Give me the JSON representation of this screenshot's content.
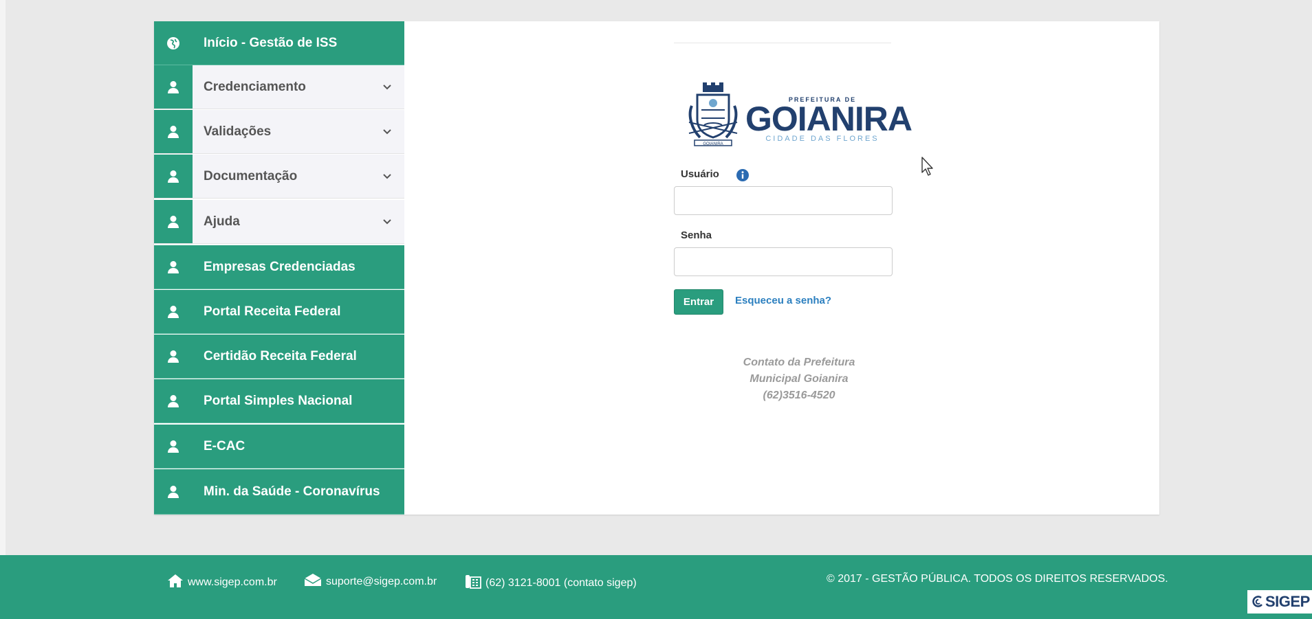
{
  "sidebar": {
    "items": [
      {
        "label": "Início - Gestão de ISS",
        "style": "green",
        "icon": "globe-icon",
        "has_submenu": false
      },
      {
        "label": "Credenciamento",
        "style": "light",
        "icon": "user-icon",
        "has_submenu": true
      },
      {
        "label": "Validações",
        "style": "light",
        "icon": "user-icon",
        "has_submenu": true
      },
      {
        "label": "Documentação",
        "style": "light",
        "icon": "user-icon",
        "has_submenu": true
      },
      {
        "label": "Ajuda",
        "style": "light",
        "icon": "user-icon",
        "has_submenu": true
      },
      {
        "label": "Empresas Credenciadas",
        "style": "green",
        "icon": "user-icon",
        "has_submenu": false
      },
      {
        "label": "Portal Receita Federal",
        "style": "green",
        "icon": "user-icon",
        "has_submenu": false
      },
      {
        "label": "Certidão Receita Federal",
        "style": "green",
        "icon": "user-icon",
        "has_submenu": false
      },
      {
        "label": "Portal Simples Nacional",
        "style": "green",
        "icon": "user-icon",
        "has_submenu": false
      },
      {
        "label": "E-CAC",
        "style": "green",
        "icon": "user-icon",
        "has_submenu": false
      },
      {
        "label": "Min. da Saúde - Coronavírus",
        "style": "green",
        "icon": "user-icon",
        "has_submenu": false
      }
    ]
  },
  "logo": {
    "top_text": "PREFEITURA DE",
    "name": "GOIANIRA",
    "tagline": "CIDADE DAS FLORES",
    "seal_text": "GOIANIRA"
  },
  "login": {
    "user_label": "Usuário",
    "user_value": "",
    "password_label": "Senha",
    "password_value": "",
    "submit_label": "Entrar",
    "forgot_label": "Esqueceu a senha?"
  },
  "contact": {
    "line1": "Contato da Prefeitura",
    "line2": "Municipal Goianira",
    "line3": "(62)3516-4520"
  },
  "footer": {
    "website": "www.sigep.com.br",
    "email": "suporte@sigep.com.br",
    "phone": "(62) 3121-8001 (contato sigep)",
    "copyright": "© 2017 - GESTÃO PÚBLICA. TODOS OS DIREITOS RESERVADOS.",
    "brand": "SIGEP"
  },
  "colors": {
    "accent": "#2a9d7e",
    "link": "#2b7fbf",
    "logo_navy": "#22406e",
    "logo_blue": "#6fa6cf"
  }
}
